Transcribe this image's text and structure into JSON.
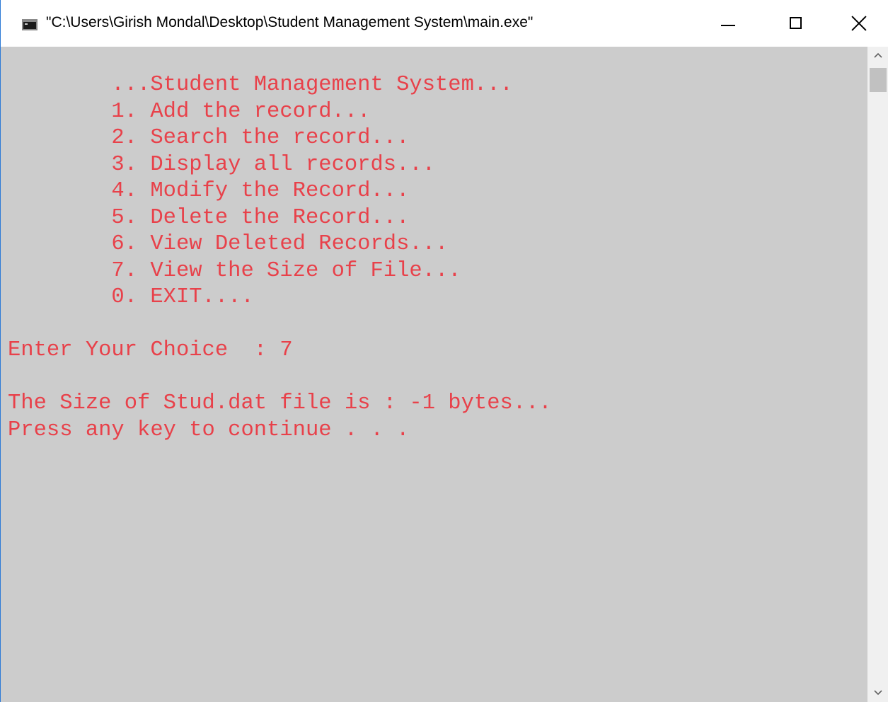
{
  "window": {
    "title": "\"C:\\Users\\Girish Mondal\\Desktop\\Student Management System\\main.exe\""
  },
  "console": {
    "lines": [
      "        ...Student Management System...",
      "        1. Add the record...",
      "        2. Search the record...",
      "        3. Display all records...",
      "        4. Modify the Record...",
      "        5. Delete the Record...",
      "        6. View Deleted Records...",
      "        7. View the Size of File...",
      "        0. EXIT....",
      "",
      "Enter Your Choice  : 7",
      "",
      "The Size of Stud.dat file is : -1 bytes...",
      "Press any key to continue . . ."
    ]
  },
  "colors": {
    "console_background": "#cccccc",
    "console_text": "#e8414a"
  },
  "icons": {
    "app": "console-app-icon",
    "minimize": "minimize-icon",
    "maximize": "maximize-icon",
    "close": "close-icon",
    "scroll_up": "chevron-up-icon",
    "scroll_down": "chevron-down-icon"
  }
}
